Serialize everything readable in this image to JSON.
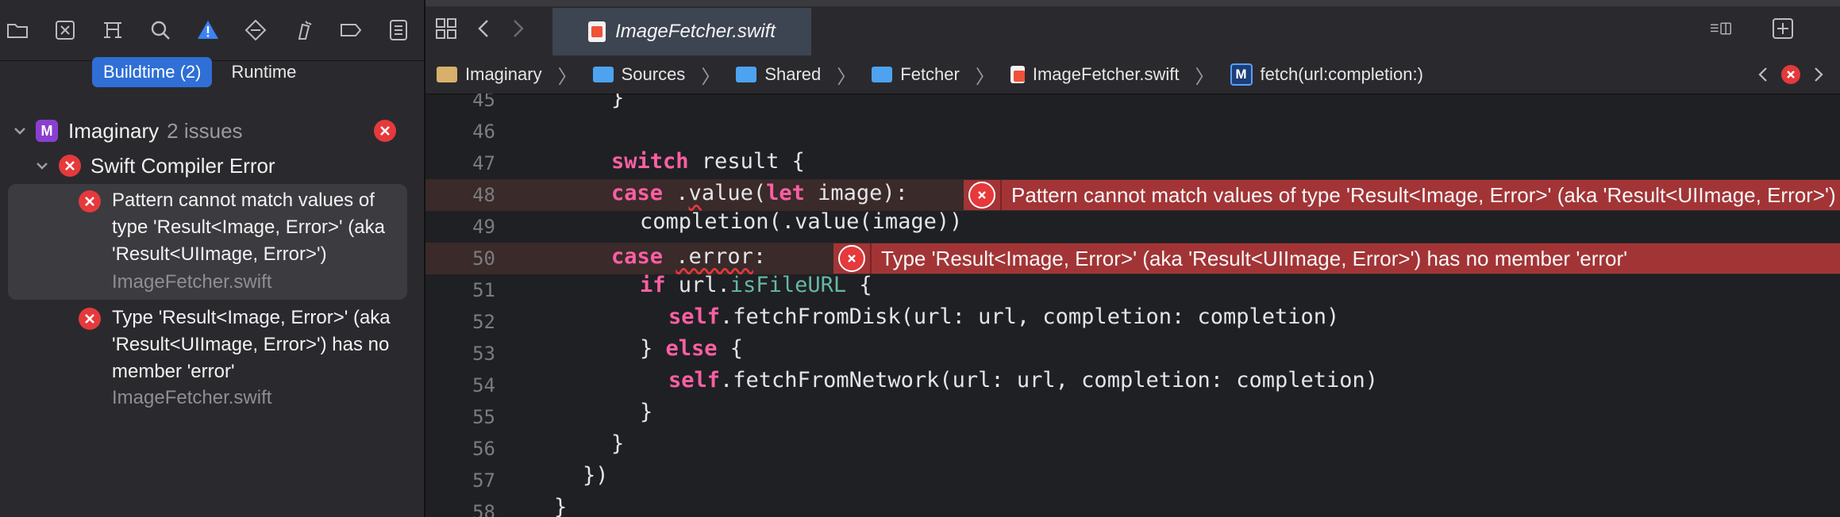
{
  "navigator": {
    "toolbar_icons": [
      "folder-icon",
      "source-control-icon",
      "symbol-icon",
      "search-icon",
      "issue-icon",
      "test-icon",
      "debug-icon",
      "breakpoint-icon",
      "report-icon"
    ],
    "segments": [
      {
        "label": "Buildtime (2)",
        "active": true
      },
      {
        "label": "Runtime",
        "active": false
      }
    ],
    "project": {
      "name": "Imaginary",
      "count": "2 issues"
    },
    "group": {
      "title": "Swift Compiler Error"
    },
    "issues": [
      {
        "message": "Pattern cannot match values of type 'Result<Image, Error>' (aka 'Result<UIImage, Error>')",
        "file": "ImageFetcher.swift",
        "selected": true
      },
      {
        "message": "Type 'Result<Image, Error>' (aka 'Result<UIImage, Error>') has no member 'error'",
        "file": "ImageFetcher.swift",
        "selected": false
      }
    ]
  },
  "editor": {
    "tab_title": "ImageFetcher.swift",
    "breadcrumbs": [
      "Imaginary",
      "Sources",
      "Shared",
      "Fetcher",
      "ImageFetcher.swift",
      "fetch(url:completion:)"
    ],
    "lines": [
      {
        "n": "45",
        "text": "}"
      },
      {
        "n": "46",
        "text": ""
      },
      {
        "n": "47",
        "text": "switch result {"
      },
      {
        "n": "48",
        "text": "case .value(let image):"
      },
      {
        "n": "49",
        "text": "completion(.value(image))"
      },
      {
        "n": "50",
        "text": "case .error:"
      },
      {
        "n": "51",
        "text": "if url.isFileURL {"
      },
      {
        "n": "52",
        "text": "self.fetchFromDisk(url: url, completion: completion)"
      },
      {
        "n": "53",
        "text": "} else {"
      },
      {
        "n": "54",
        "text": "self.fetchFromNetwork(url: url, completion: completion)"
      },
      {
        "n": "55",
        "text": "}"
      },
      {
        "n": "56",
        "text": "}"
      },
      {
        "n": "57",
        "text": "})"
      },
      {
        "n": "58",
        "text": "}"
      }
    ],
    "errors": [
      {
        "line": "48",
        "message": "Pattern cannot match values of type 'Result<Image, Error>' (aka 'Result<UIImage, Error>')"
      },
      {
        "line": "50",
        "message": "Type 'Result<Image, Error>' (aka 'Result<UIImage, Error>') has no member 'error'"
      }
    ]
  },
  "colors": {
    "accent": "#2f6fd6",
    "error": "#e5393c",
    "error_banner": "#a23436",
    "keyword": "#fc5fa3"
  }
}
